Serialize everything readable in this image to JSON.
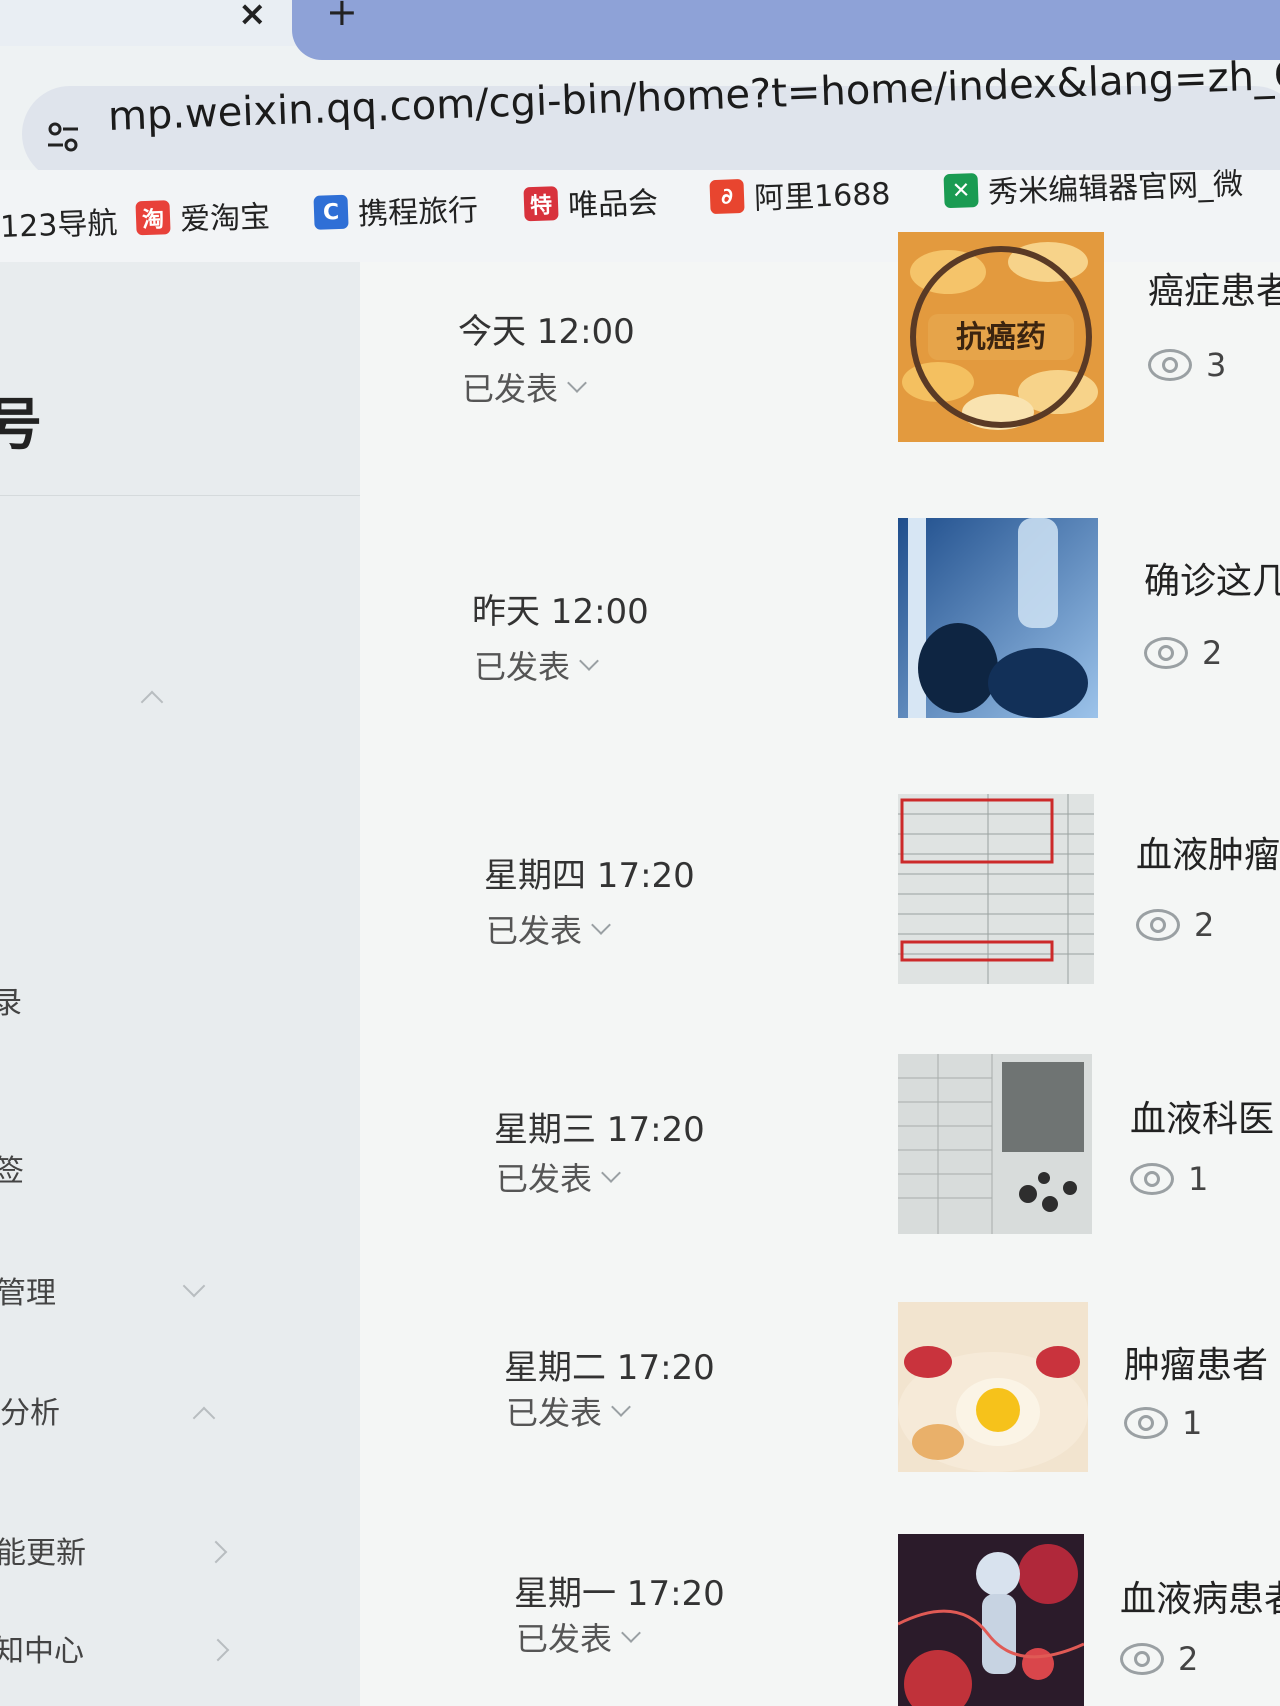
{
  "browser": {
    "tab_close": "×",
    "new_tab": "+",
    "url": "mp.weixin.qq.com/cgi-bin/home?t=home/index&lang=zh_CN&toke",
    "bookmarks": [
      {
        "label": "123导航",
        "icon": "none"
      },
      {
        "label": "爱淘宝",
        "icon": "taobao-icon",
        "glyph": "淘",
        "color": "#e8413a"
      },
      {
        "label": "携程旅行",
        "icon": "ctrip-icon",
        "glyph": "C",
        "color": "#2f6fd6"
      },
      {
        "label": "唯品会",
        "icon": "vip-icon",
        "glyph": "特",
        "color": "#d8323c"
      },
      {
        "label": "阿里1688",
        "icon": "alibaba-1688-icon",
        "glyph": "∂",
        "color": "#e8452f"
      },
      {
        "label": "秀米编辑器官网_微",
        "icon": "xiumi-icon",
        "glyph": "✕",
        "color": "#1a9b52"
      }
    ]
  },
  "sidebar": {
    "heading_fragment": "号",
    "items": [
      {
        "label": "",
        "chevron": "up"
      },
      {
        "label": "录",
        "chevron": "none"
      },
      {
        "label": "签",
        "chevron": "none"
      },
      {
        "label": "管理",
        "chevron": "down"
      },
      {
        "label": "分析",
        "chevron": "up"
      },
      {
        "label": "能更新",
        "chevron": "right"
      },
      {
        "label": "知中心",
        "chevron": "right"
      }
    ]
  },
  "articles": [
    {
      "time": "今天 12:00",
      "status": "已发表",
      "title": "癌症患者",
      "views": "3",
      "thumb": "pills",
      "thumb_text": "抗癌药"
    },
    {
      "time": "昨天 12:00",
      "status": "已发表",
      "title": "确诊这几",
      "views": "2",
      "thumb": "hospital-iv"
    },
    {
      "time": "星期四 17:20",
      "status": "已发表",
      "title": "血液肿瘤",
      "views": "2",
      "thumb": "lab-report"
    },
    {
      "time": "星期三 17:20",
      "status": "已发表",
      "title": "血液科医",
      "views": "1",
      "thumb": "scan-doc"
    },
    {
      "time": "星期二 17:20",
      "status": "已发表",
      "title": "肿瘤患者",
      "views": "1",
      "thumb": "food-bowl"
    },
    {
      "time": "星期一 17:20",
      "status": "已发表",
      "title": "血液病患者",
      "views": "2",
      "thumb": "cells"
    }
  ]
}
